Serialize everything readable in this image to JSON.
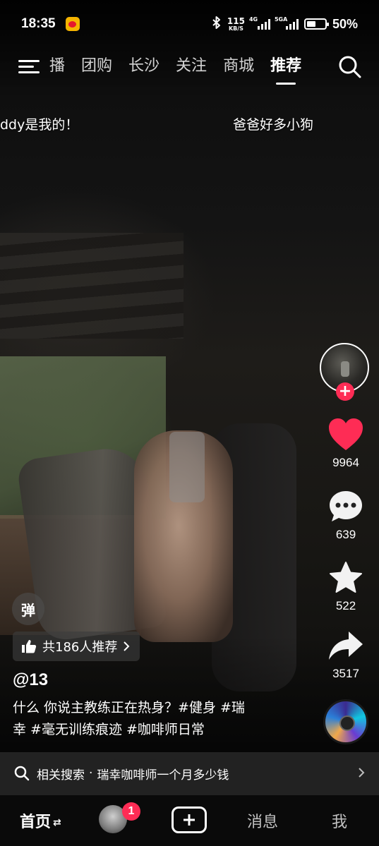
{
  "status_bar": {
    "time": "18:35",
    "speed_value": "115",
    "speed_unit": "KB/S",
    "signal1_label": "4G",
    "signal2_label": "5GA",
    "battery_percent": "50%",
    "battery_level": 0.5
  },
  "top_nav": {
    "tabs": [
      {
        "label": "播",
        "active": false
      },
      {
        "label": "团购",
        "active": false
      },
      {
        "label": "长沙",
        "active": false
      },
      {
        "label": "关注",
        "active": false
      },
      {
        "label": "商城",
        "active": false
      },
      {
        "label": "推荐",
        "active": true
      }
    ]
  },
  "danmaku": [
    {
      "text": "ddy是我的！"
    },
    {
      "text": "爸爸好多小狗"
    }
  ],
  "right_rail": {
    "like_count": "9964",
    "comment_count": "639",
    "favorite_count": "522",
    "share_count": "3517",
    "follow_symbol": "+"
  },
  "info": {
    "danmu_toggle_label": "弹",
    "recommend_text": "共186人推荐",
    "author": "@13",
    "caption_line1": "什么 你说主教练正在热身？#健身 #瑞",
    "caption_line2": "幸 #毫无训练痕迹 #咖啡师日常"
  },
  "related_search": {
    "label": "相关搜索",
    "separator": "·",
    "query": "瑞幸咖啡师一个月多少钱"
  },
  "tab_bar": {
    "home": "首页",
    "friends_badge": "1",
    "messages": "消息",
    "me": "我"
  },
  "colors": {
    "accent": "#fe2c55",
    "background": "#000000"
  }
}
